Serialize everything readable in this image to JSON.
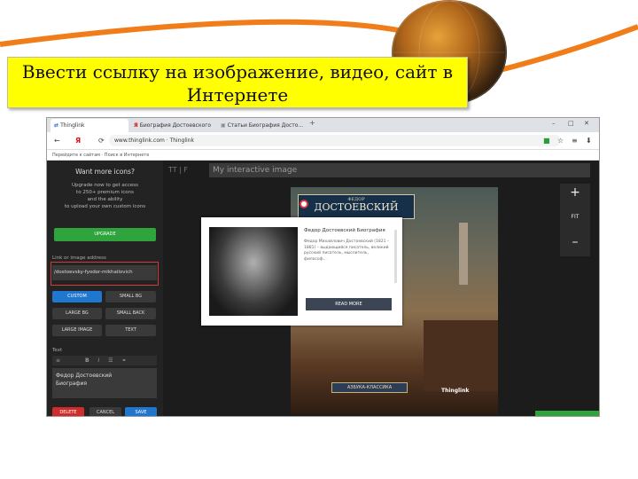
{
  "slide": {
    "title_line1": "Ввести ссылку на изображение, видео, сайт в",
    "title_line2": "Интернете"
  },
  "browser": {
    "tabs": [
      {
        "label": "Thinglink",
        "active": true
      },
      {
        "label": "Биография Достоевского",
        "active": false
      },
      {
        "label": "Статьи Биография Досто...",
        "active": false
      }
    ],
    "new_tab": "+",
    "window_controls": [
      "–",
      "□",
      "✕"
    ],
    "address_url": "www.thinglink.com · Thinglink",
    "bookmark": "Перейдите к сайтам · Поиск в Интернете"
  },
  "sidebar": {
    "heading": "Want more icons?",
    "info_line1": "Upgrade now to get access",
    "info_line2": "to 250+ premium icons",
    "info_line3": "and the ability",
    "info_line4": "to upload your own custom icons",
    "upgrade_label": "UPGRADE",
    "link_label": "Link or image address",
    "link_value": "/dostoevsky-fyodor-mikhailovich",
    "buttons": [
      "CUSTOM",
      "SMALL BG",
      "LARGE BG",
      "SMALL BACK",
      "LARGE IMAGE",
      "TEXT"
    ],
    "text_label": "Text",
    "textarea_line1": "Федор Достоевский",
    "textarea_line2": "Биография",
    "delete_label": "DELETE",
    "cancel_label": "CANCEL",
    "save_label": "SAVE"
  },
  "canvas": {
    "title_placeholder": "My interactive image",
    "zoom_in": "+",
    "fit_label": "FIT",
    "zoom_out": "–",
    "book_author_small": "ФЕДОР",
    "book_author": "ДОСТОЕВСКИЙ",
    "book_series": "АЗБУКА-КЛАССИКА",
    "watermark": "Thinglink"
  },
  "popup": {
    "title": "Федор Достоевский Биография",
    "body": "Федор Михайлович Достоевский (1821 – 1881) – выдающийся писатель, великий русский писатель, мыслитель, философ...",
    "read_more": "READ MORE"
  }
}
